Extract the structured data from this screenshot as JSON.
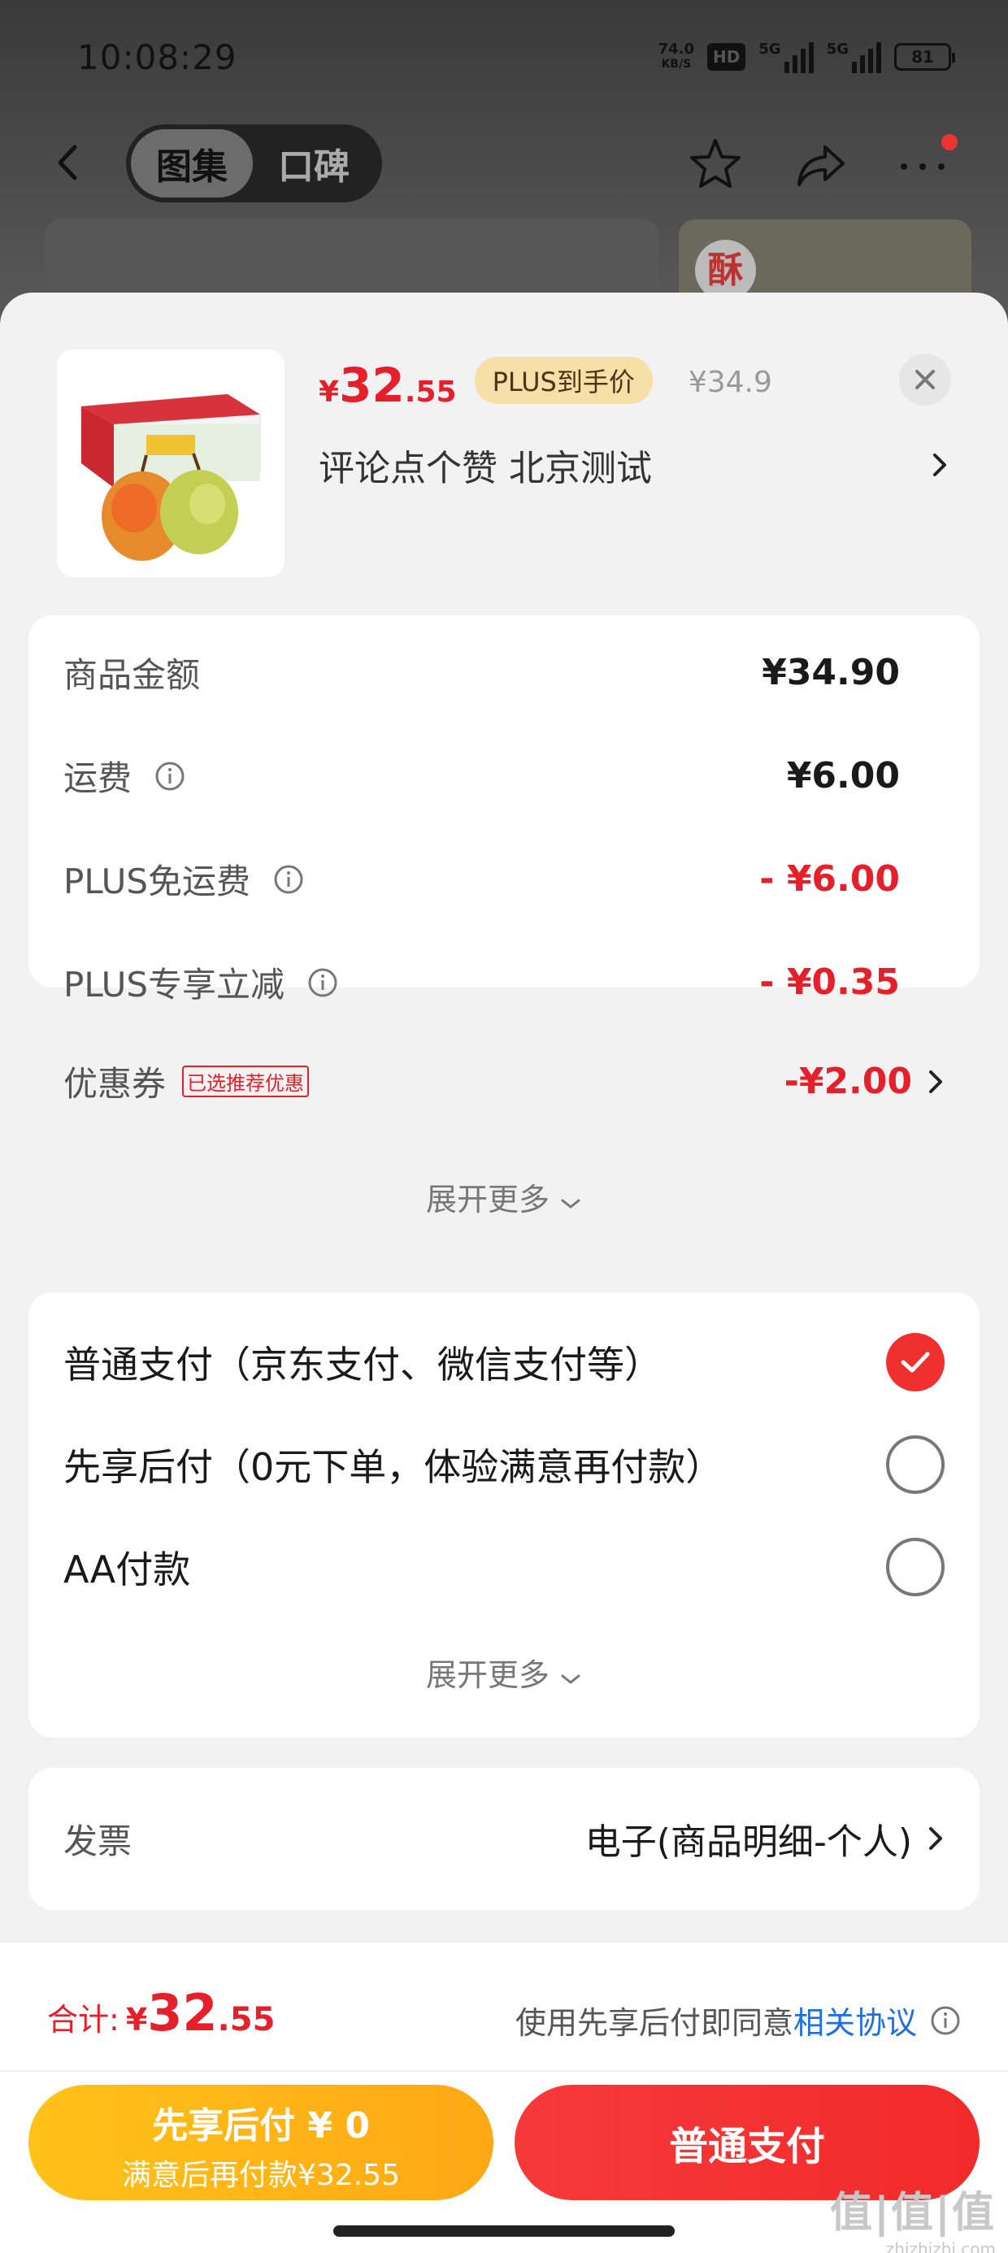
{
  "status_bar": {
    "time": "10:08:29",
    "net_speed": "74.0",
    "net_unit": "KB/S",
    "hd": "HD",
    "sig1_label": "5G",
    "sig2_label": "5G",
    "battery": "81"
  },
  "nav": {
    "tabs": [
      "图集",
      "口碑"
    ],
    "active_tab": 0
  },
  "background": {
    "thumb_tag": "酥"
  },
  "product": {
    "price_yen": "¥",
    "price_int": "32",
    "price_dec": ".55",
    "plus_badge": "PLUS到手价",
    "original_price": "¥34.9",
    "sku_text": "评论点个赞  北京测试"
  },
  "amounts": {
    "rows": [
      {
        "label": "商品金额",
        "value": "¥34.90"
      },
      {
        "label": "运费",
        "value": "¥6.00"
      },
      {
        "label": "PLUS免运费",
        "value": "- ¥6.00"
      },
      {
        "label": "PLUS专享立减",
        "value": "- ¥0.35"
      },
      {
        "label": "优惠券",
        "tag": "已选推荐优惠",
        "value": "-¥2.00"
      }
    ],
    "expand_label": "展开更多"
  },
  "payment": {
    "options": [
      {
        "label": "普通支付（京东支付、微信支付等）",
        "checked": true
      },
      {
        "label": "先享后付（0元下单，体验满意再付款）",
        "checked": false
      },
      {
        "label": "AA付款",
        "checked": false
      }
    ],
    "expand_label": "展开更多"
  },
  "invoice": {
    "label": "发票",
    "value": "电子(商品明细-个人)"
  },
  "footer": {
    "total_label": "合计:",
    "total_yen": "¥",
    "total_int": "32",
    "total_dec": ".55",
    "agree_text": "使用先享后付即同意",
    "agree_link": "相关协议",
    "btn_later_line1": "先享后付 ¥ 0",
    "btn_later_line2": "满意后再付款¥32.55",
    "btn_normal": "普通支付",
    "watermark_1": "值|值|值",
    "watermark_2": "zhizhizhi.com"
  },
  "colors": {
    "accent_red": "#e5202a",
    "plus_gold": "#f7dfa8",
    "later_button": "#ffb518",
    "link_blue": "#1f6fe0"
  }
}
